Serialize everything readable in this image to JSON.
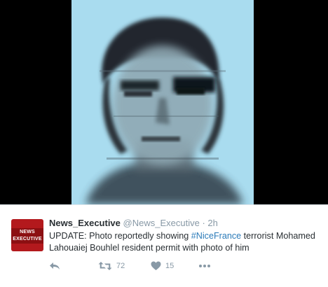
{
  "media": {
    "image_icon": "photo-of-face"
  },
  "tweet": {
    "avatar": {
      "line1": "NEWS",
      "line2": "EXECUTIVE",
      "bg_color": "#b3191d"
    },
    "name": "News_Executive",
    "handle": "@News_Executive",
    "separator": "·",
    "time": "2h",
    "text_before": "UPDATE: Photo reportedly showing ",
    "hashtag": "#NiceFrance",
    "text_after": " terrorist Mohamed Lahouaiej Bouhlel resident permit with photo of him",
    "actions": {
      "reply_icon": "reply-icon",
      "retweet_icon": "retweet-icon",
      "retweet_count": "72",
      "like_icon": "heart-icon",
      "like_count": "15",
      "more_icon": "more-icon"
    },
    "colors": {
      "link": "#2b7bb9",
      "muted": "#8899a6",
      "text": "#292f33"
    }
  }
}
